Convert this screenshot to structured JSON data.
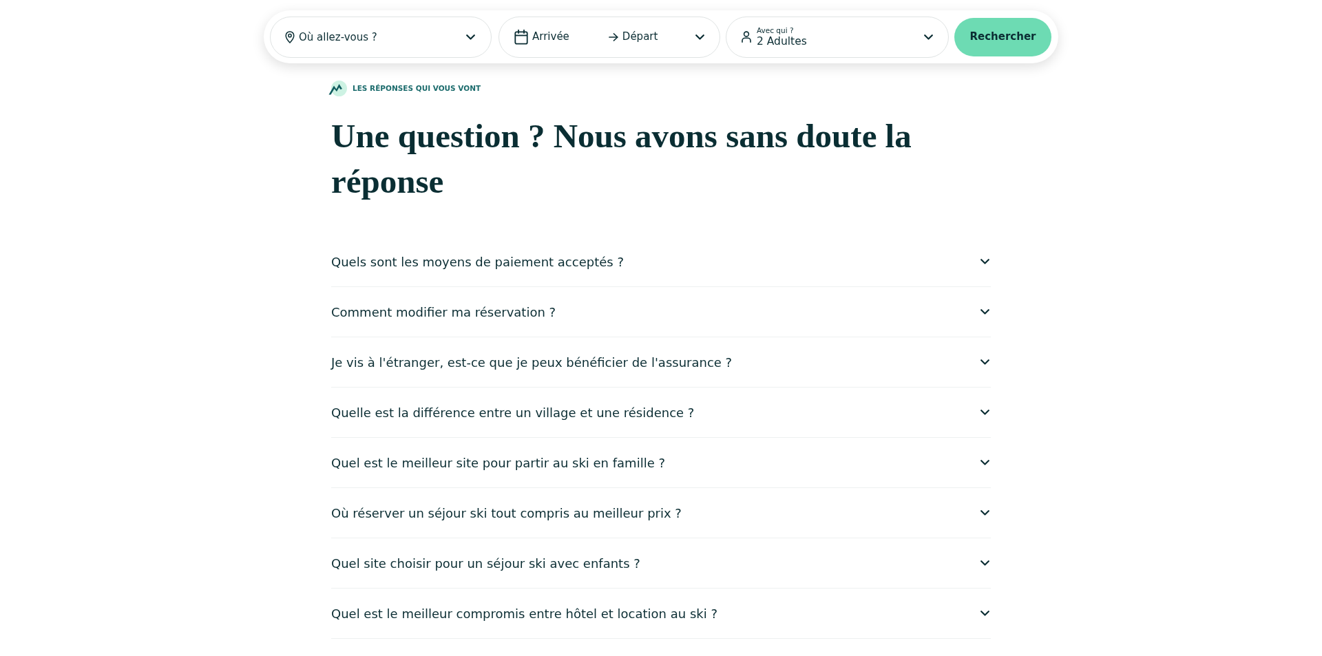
{
  "search_bar": {
    "destination": {
      "placeholder": "Où allez-vous ?"
    },
    "dates": {
      "arrival": "Arrivée",
      "departure": "Départ"
    },
    "guests": {
      "label": "Avec qui ?",
      "value": "2 Adultes"
    },
    "button": "Rechercher"
  },
  "section": {
    "eyebrow": "LES RÉPONSES QUI VOUS VONT",
    "title": "Une question ? Nous avons sans doute la réponse"
  },
  "faq": [
    {
      "question": "Quels sont les moyens de paiement acceptés ?",
      "expanded": false
    },
    {
      "question": "Comment modifier ma réservation ?",
      "expanded": false
    },
    {
      "question": "Je vis à l'étranger, est-ce que je peux bénéficier de l'assurance ?",
      "expanded": false
    },
    {
      "question": "Quelle est la différence entre un village et une résidence ?",
      "expanded": false
    },
    {
      "question": "Quel est le meilleur site pour partir au ski en famille ?",
      "expanded": false
    },
    {
      "question": "Où réserver un séjour ski tout compris au meilleur prix ?",
      "expanded": false
    },
    {
      "question": "Quel site choisir pour un séjour ski avec enfants ?",
      "expanded": false
    },
    {
      "question": "Quel est le meilleur compromis entre hôtel et location au ski ?",
      "expanded": false
    }
  ]
}
